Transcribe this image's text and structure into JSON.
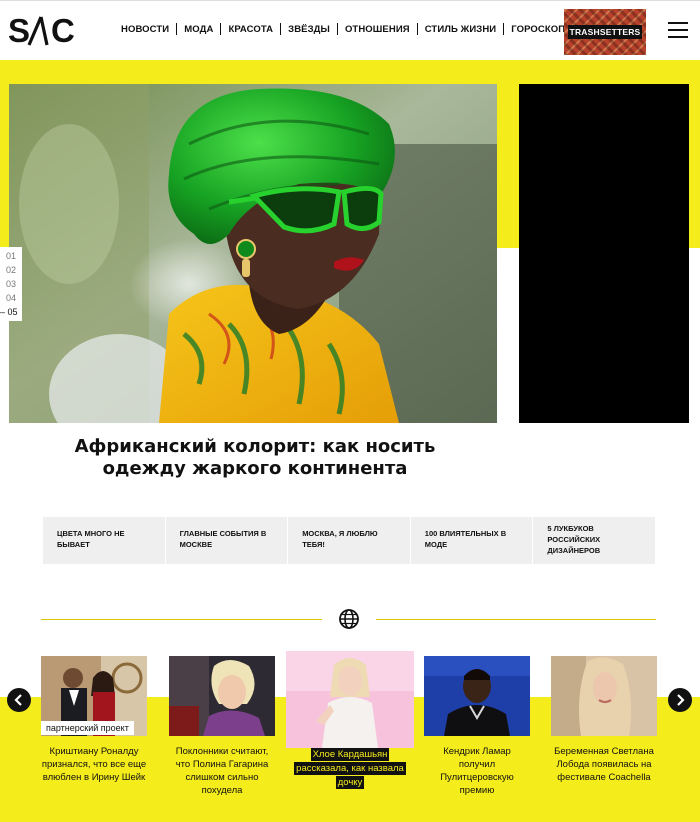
{
  "brand": {
    "logo_text": "S/\\C"
  },
  "nav": {
    "items": [
      {
        "label": "НОВОСТИ"
      },
      {
        "label": "МОДА"
      },
      {
        "label": "КРАСОТА"
      },
      {
        "label": "ЗВЁЗДЫ"
      },
      {
        "label": "ОТНОШЕНИЯ"
      },
      {
        "label": "СТИЛЬ ЖИЗНИ"
      },
      {
        "label": "ГОРОСКОП"
      }
    ]
  },
  "header_ad": {
    "text": "TRASHSETTERS"
  },
  "hero": {
    "slides": [
      "01",
      "02",
      "03",
      "04",
      "05"
    ],
    "active_slide": "05",
    "title": "Африканский колорит: как носить одежду жаркого континента"
  },
  "topics": [
    {
      "label": "ЦВЕТА МНОГО НЕ БЫВАЕТ"
    },
    {
      "label": "ГЛАВНЫЕ СОБЫТИЯ В МОСКВЕ"
    },
    {
      "label": "МОСКВА, Я ЛЮБЛЮ ТЕБЯ!"
    },
    {
      "label": "100 ВЛИЯТЕЛЬНЫХ В МОДЕ"
    },
    {
      "label": "5 ЛУКБУКОВ РОССИЙСКИХ ДИЗАЙНЕРОВ"
    }
  ],
  "carousel": {
    "cards": [
      {
        "caption": "Криштиану Роналду признался, что все еще влюблен в Ирину Шейк",
        "badge": "партнерский проект"
      },
      {
        "caption": "Поклонники считают, что Полина Гагарина слишком сильно похудела"
      },
      {
        "caption": "Хлое Кардашьян рассказала, как назвала дочку"
      },
      {
        "caption": "Кендрик Ламар получил Пулитцеровскую премию"
      },
      {
        "caption": "Беременная Светлана Лобода появилась на фестивале Coachella"
      }
    ]
  },
  "colors": {
    "accent": "#f5ec1c",
    "dark": "#111111"
  },
  "icons": {
    "divider": "globe-icon",
    "prev": "chevron-left-icon",
    "next": "chevron-right-icon",
    "menu": "hamburger-icon"
  }
}
